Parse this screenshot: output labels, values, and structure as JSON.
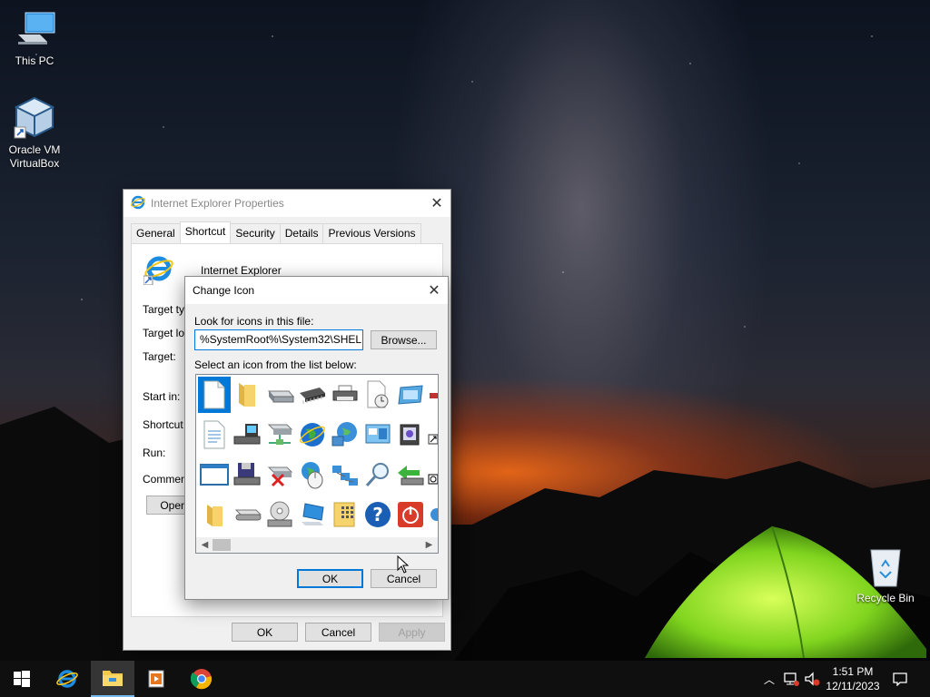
{
  "desktop": {
    "icons": [
      {
        "label": "This PC",
        "icon": "computer-icon"
      },
      {
        "label_line1": "Oracle VM",
        "label_line2": "VirtualBox",
        "icon": "virtualbox-icon"
      },
      {
        "label": "Recycle Bin",
        "icon": "recycle-bin-icon"
      }
    ]
  },
  "props_window": {
    "title": "Internet Explorer Properties",
    "tabs": [
      "General",
      "Shortcut",
      "Security",
      "Details",
      "Previous Versions"
    ],
    "active_tab": "Shortcut",
    "app_name": "Internet Explorer",
    "fields": {
      "target_type": "Target typ",
      "target_location": "Target loc",
      "target": "Target:",
      "start_in": "Start in:",
      "shortcut_key": "Shortcut k",
      "run": "Run:",
      "comment": "Comment:"
    },
    "open_button": "Open",
    "ok": "OK",
    "cancel": "Cancel",
    "apply": "Apply"
  },
  "change_icon": {
    "title": "Change Icon",
    "look_label": "Look for icons in this file:",
    "file_path": "%SystemRoot%\\System32\\SHELL32.dll",
    "browse": "Browse...",
    "select_label": "Select an icon from the list below:",
    "ok": "OK",
    "cancel": "Cancel",
    "icons": [
      [
        "blank-document-icon",
        "folder-icon",
        "drive-icon",
        "memory-chip-icon",
        "printer-icon",
        "clock-document-icon",
        "window-icon",
        "partial-icon"
      ],
      [
        "text-document-icon",
        "computer-drive-icon",
        "network-drive-icon",
        "globe-icon",
        "network-globe-icon",
        "control-panel-icon",
        "app-window-icon",
        "shortcut-arrow-icon"
      ],
      [
        "window-frame-icon",
        "floppy-icon",
        "disconnected-drive-icon",
        "mouse-globe-icon",
        "network-icon",
        "search-icon",
        "green-arrow-icon",
        "partial-icon"
      ],
      [
        "folder-open-icon",
        "removable-drive-icon",
        "cd-drive-icon",
        "monitor-icon",
        "grid-folder-icon",
        "help-icon",
        "power-icon",
        "partial-icon"
      ]
    ]
  },
  "taskbar": {
    "apps": [
      "start-icon",
      "internet-explorer-icon",
      "file-explorer-icon",
      "media-player-icon",
      "chrome-icon"
    ],
    "active_app": "file-explorer-icon",
    "time": "1:51 PM",
    "date": "12/11/2023"
  }
}
